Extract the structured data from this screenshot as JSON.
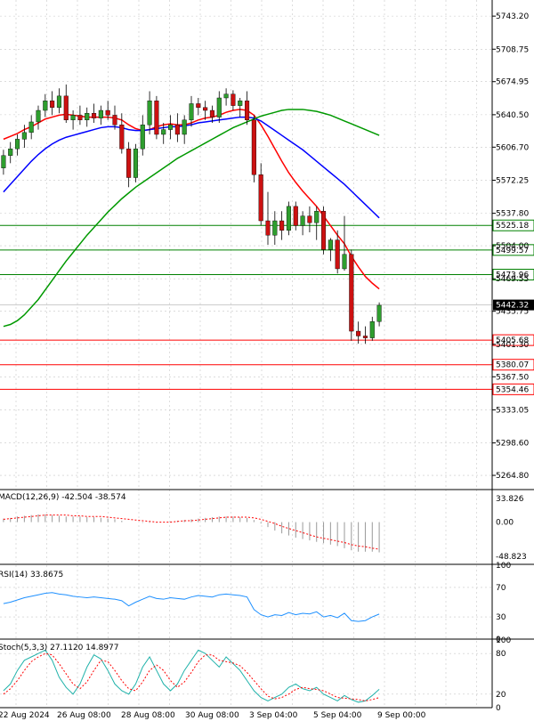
{
  "chart_data": [
    {
      "type": "candlestick",
      "ylim": [
        5250,
        5760
      ],
      "yticks": [
        "5743.20",
        "5708.75",
        "5674.95",
        "5640.50",
        "5606.70",
        "5572.25",
        "5537.80",
        "5504.00",
        "5469.55",
        "5435.75",
        "5401.30",
        "5367.50",
        "5333.05",
        "5298.60",
        "5264.80"
      ],
      "x_labels": [
        "22 Aug 2024",
        "26 Aug 08:00",
        "28 Aug 08:00",
        "30 Aug 08:00",
        "3 Sep 04:00",
        "5 Sep 04:00",
        "9 Sep 00:00"
      ],
      "current_price": {
        "label": "5442.32",
        "value": 5442.32,
        "color": "#000000"
      },
      "levels": [
        {
          "label": "5525.18",
          "value": 5525.18,
          "color": "#008000"
        },
        {
          "label": "5499.57",
          "value": 5499.57,
          "color": "#008000"
        },
        {
          "label": "5473.96",
          "value": 5473.96,
          "color": "#008000"
        },
        {
          "label": "5405.68",
          "value": 5405.68,
          "color": "#ff0000"
        },
        {
          "label": "5380.07",
          "value": 5380.07,
          "color": "#ff0000"
        },
        {
          "label": "5354.46",
          "value": 5354.46,
          "color": "#ff0000"
        }
      ],
      "ohlc": [
        [
          5585,
          5604,
          5578,
          5598
        ],
        [
          5598,
          5612,
          5590,
          5605
        ],
        [
          5605,
          5620,
          5598,
          5615
        ],
        [
          5615,
          5630,
          5606,
          5622
        ],
        [
          5622,
          5640,
          5615,
          5633
        ],
        [
          5633,
          5650,
          5625,
          5645
        ],
        [
          5645,
          5662,
          5638,
          5655
        ],
        [
          5655,
          5665,
          5640,
          5648
        ],
        [
          5648,
          5668,
          5642,
          5660
        ],
        [
          5660,
          5672,
          5632,
          5635
        ],
        [
          5635,
          5645,
          5625,
          5640
        ],
        [
          5640,
          5650,
          5630,
          5635
        ],
        [
          5635,
          5648,
          5628,
          5642
        ],
        [
          5642,
          5652,
          5632,
          5637
        ],
        [
          5637,
          5650,
          5630,
          5645
        ],
        [
          5645,
          5655,
          5635,
          5640
        ],
        [
          5640,
          5650,
          5625,
          5630
        ],
        [
          5630,
          5642,
          5600,
          5605
        ],
        [
          5605,
          5612,
          5565,
          5575
        ],
        [
          5575,
          5610,
          5570,
          5605
        ],
        [
          5605,
          5640,
          5598,
          5630
        ],
        [
          5630,
          5665,
          5620,
          5655
        ],
        [
          5655,
          5660,
          5615,
          5620
        ],
        [
          5620,
          5632,
          5610,
          5625
        ],
        [
          5625,
          5640,
          5615,
          5630
        ],
        [
          5630,
          5642,
          5612,
          5620
        ],
        [
          5620,
          5640,
          5610,
          5635
        ],
        [
          5635,
          5660,
          5628,
          5652
        ],
        [
          5652,
          5658,
          5640,
          5648
        ],
        [
          5648,
          5655,
          5635,
          5645
        ],
        [
          5645,
          5650,
          5632,
          5638
        ],
        [
          5638,
          5665,
          5632,
          5658
        ],
        [
          5658,
          5668,
          5650,
          5662
        ],
        [
          5662,
          5666,
          5645,
          5650
        ],
        [
          5650,
          5658,
          5638,
          5655
        ],
        [
          5655,
          5665,
          5630,
          5635
        ],
        [
          5635,
          5640,
          5570,
          5578
        ],
        [
          5578,
          5590,
          5525,
          5530
        ],
        [
          5530,
          5560,
          5505,
          5515
        ],
        [
          5515,
          5540,
          5505,
          5530
        ],
        [
          5530,
          5540,
          5510,
          5520
        ],
        [
          5520,
          5550,
          5515,
          5545
        ],
        [
          5545,
          5550,
          5520,
          5525
        ],
        [
          5525,
          5540,
          5515,
          5535
        ],
        [
          5535,
          5545,
          5518,
          5528
        ],
        [
          5528,
          5545,
          5510,
          5540
        ],
        [
          5540,
          5545,
          5495,
          5500
        ],
        [
          5500,
          5512,
          5488,
          5510
        ],
        [
          5510,
          5520,
          5475,
          5480
        ],
        [
          5480,
          5535,
          5478,
          5495
        ],
        [
          5495,
          5500,
          5405,
          5415
        ],
        [
          5415,
          5425,
          5402,
          5410
        ],
        [
          5410,
          5420,
          5402,
          5408
        ],
        [
          5408,
          5430,
          5405,
          5425
        ],
        [
          5425,
          5445,
          5420,
          5442
        ]
      ],
      "series": [
        {
          "name": "MA fast",
          "color": "#ff0000",
          "values": [
            5615,
            5618,
            5621,
            5625,
            5628,
            5632,
            5636,
            5638,
            5640,
            5641,
            5640,
            5639,
            5638,
            5638,
            5638,
            5638,
            5637,
            5635,
            5630,
            5626,
            5624,
            5625,
            5628,
            5630,
            5631,
            5630,
            5630,
            5632,
            5635,
            5637,
            5638,
            5640,
            5643,
            5645,
            5646,
            5645,
            5640,
            5630,
            5618,
            5605,
            5592,
            5580,
            5570,
            5561,
            5553,
            5545,
            5535,
            5525,
            5515,
            5506,
            5493,
            5482,
            5472,
            5465,
            5459
          ]
        },
        {
          "name": "MA mid",
          "color": "#0000ff",
          "values": [
            5560,
            5568,
            5576,
            5584,
            5592,
            5599,
            5605,
            5610,
            5614,
            5617,
            5619,
            5621,
            5623,
            5625,
            5627,
            5628,
            5628,
            5627,
            5625,
            5624,
            5624,
            5625,
            5626,
            5627,
            5628,
            5628,
            5629,
            5630,
            5632,
            5633,
            5634,
            5635,
            5636,
            5637,
            5638,
            5638,
            5637,
            5634,
            5629,
            5624,
            5619,
            5614,
            5609,
            5604,
            5598,
            5592,
            5586,
            5580,
            5574,
            5568,
            5561,
            5554,
            5547,
            5540,
            5533
          ]
        },
        {
          "name": "MA slow",
          "color": "#009900",
          "values": [
            5420,
            5422,
            5426,
            5432,
            5440,
            5448,
            5458,
            5468,
            5478,
            5488,
            5497,
            5506,
            5515,
            5523,
            5531,
            5539,
            5546,
            5553,
            5559,
            5565,
            5570,
            5575,
            5580,
            5585,
            5590,
            5595,
            5599,
            5603,
            5607,
            5611,
            5615,
            5619,
            5623,
            5627,
            5630,
            5633,
            5636,
            5639,
            5641,
            5643,
            5645,
            5646,
            5646,
            5646,
            5645,
            5644,
            5642,
            5640,
            5637,
            5634,
            5631,
            5628,
            5625,
            5622,
            5619
          ]
        }
      ]
    },
    {
      "type": "bar",
      "title": "MACD(12,26,9) -42.504 -38.574",
      "ylim": [
        -60,
        45
      ],
      "yticks": [
        "33.826",
        "0.00",
        "-48.823"
      ],
      "values": [
        5,
        6,
        8,
        9,
        10,
        11,
        11,
        10,
        9,
        8,
        8,
        8,
        7,
        7,
        6,
        5,
        4,
        2,
        0,
        0,
        -1,
        -1,
        -1,
        0,
        1,
        2,
        3,
        4,
        5,
        6,
        7,
        8,
        8,
        8,
        7,
        6,
        3,
        -2,
        -7,
        -12,
        -16,
        -19,
        -22,
        -24,
        -26,
        -28,
        -30,
        -32,
        -34,
        -37,
        -40,
        -42,
        -42,
        -42,
        -43
      ],
      "signal": [
        4,
        5,
        6,
        7,
        8,
        9,
        10,
        10,
        10,
        10,
        9,
        9,
        8,
        8,
        8,
        7,
        6,
        5,
        4,
        3,
        2,
        1,
        0,
        0,
        0,
        1,
        2,
        2,
        3,
        4,
        5,
        6,
        7,
        7,
        7,
        7,
        6,
        4,
        1,
        -2,
        -6,
        -9,
        -12,
        -15,
        -18,
        -21,
        -23,
        -25,
        -27,
        -29,
        -32,
        -34,
        -35,
        -37,
        -38.5
      ]
    },
    {
      "type": "line",
      "title": "RSI(14) 33.8675",
      "ylim": [
        0,
        100
      ],
      "yticks": [
        "100",
        "70",
        "30",
        "0"
      ],
      "values": [
        48,
        50,
        53,
        56,
        58,
        60,
        62,
        63,
        61,
        60,
        58,
        57,
        56,
        57,
        56,
        55,
        54,
        52,
        45,
        50,
        54,
        58,
        55,
        54,
        56,
        55,
        54,
        57,
        59,
        58,
        57,
        60,
        61,
        60,
        59,
        57,
        40,
        33,
        30,
        33,
        32,
        36,
        33,
        35,
        34,
        37,
        30,
        32,
        29,
        35,
        25,
        24,
        25,
        30,
        33.87
      ]
    },
    {
      "type": "line",
      "title": "Stoch(5,3,3) 27.1120 14.8977",
      "ylim": [
        0,
        100
      ],
      "yticks": [
        "100",
        "80",
        "20",
        "0"
      ],
      "values": [
        25,
        35,
        55,
        70,
        75,
        80,
        85,
        70,
        45,
        30,
        20,
        35,
        60,
        78,
        72,
        55,
        35,
        25,
        20,
        35,
        60,
        75,
        55,
        35,
        25,
        35,
        55,
        70,
        85,
        80,
        70,
        60,
        75,
        65,
        55,
        40,
        25,
        15,
        10,
        15,
        20,
        30,
        35,
        28,
        25,
        30,
        20,
        15,
        10,
        18,
        12,
        8,
        10,
        18,
        27.11
      ],
      "signal": [
        20,
        28,
        40,
        55,
        68,
        75,
        80,
        78,
        65,
        50,
        35,
        28,
        38,
        55,
        70,
        68,
        55,
        40,
        28,
        25,
        38,
        55,
        63,
        55,
        40,
        30,
        38,
        52,
        68,
        78,
        78,
        70,
        68,
        66,
        62,
        52,
        40,
        28,
        17,
        13,
        15,
        20,
        27,
        30,
        28,
        27,
        25,
        20,
        15,
        14,
        13,
        12,
        10,
        12,
        14.9
      ]
    }
  ]
}
